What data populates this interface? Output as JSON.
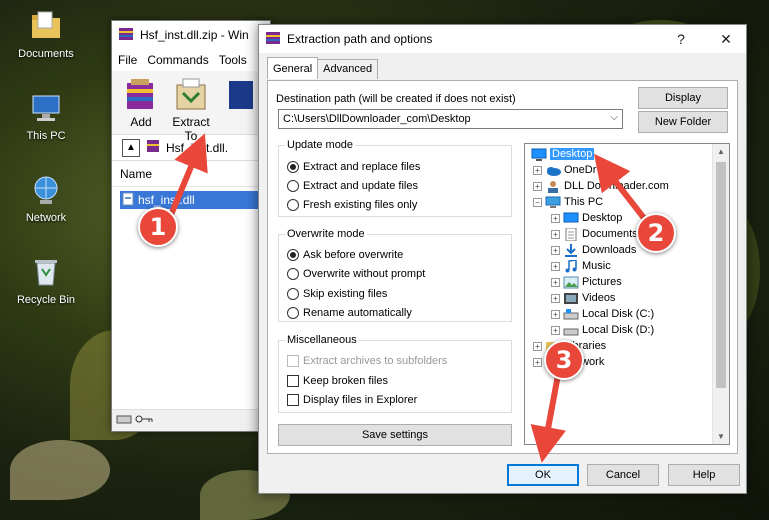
{
  "desktop": {
    "icons": [
      {
        "label": "Documents",
        "icon": "documents-folder-icon"
      },
      {
        "label": "This PC",
        "icon": "this-pc-icon"
      },
      {
        "label": "Network",
        "icon": "network-icon"
      },
      {
        "label": "Recycle Bin",
        "icon": "recycle-bin-icon"
      }
    ]
  },
  "winrar": {
    "title": "Hsf_inst.dll.zip - Win",
    "menu": [
      "File",
      "Commands",
      "Tools"
    ],
    "tools": [
      {
        "label": "Add",
        "icon": "add-archive-icon"
      },
      {
        "label": "Extract To",
        "icon": "extract-to-icon"
      }
    ],
    "address": "Hsf_inst.dll.",
    "column_name": "Name",
    "file": "hsf_inst.dll"
  },
  "dialog": {
    "title": "Extraction path and options",
    "help": "?",
    "close": "✕",
    "tabs": [
      "General",
      "Advanced"
    ],
    "dest_label": "Destination path (will be created if does not exist)",
    "dest_value": "C:\\Users\\DllDownloader_com\\Desktop",
    "display_btn": "Display",
    "new_folder_btn": "New Folder",
    "update_mode": {
      "title": "Update mode",
      "options": [
        "Extract and replace files",
        "Extract and update files",
        "Fresh existing files only"
      ],
      "selected": 0
    },
    "overwrite_mode": {
      "title": "Overwrite mode",
      "options": [
        "Ask before overwrite",
        "Overwrite without prompt",
        "Skip existing files",
        "Rename automatically"
      ],
      "selected": 0
    },
    "misc": {
      "title": "Miscellaneous",
      "options": [
        "Extract archives to subfolders",
        "Keep broken files",
        "Display files in Explorer"
      ]
    },
    "save_settings": "Save settings",
    "tree": [
      {
        "label": "Desktop",
        "level": 0,
        "icon": "desktop-icon",
        "selected": true
      },
      {
        "label": "OneDr",
        "level": 1,
        "icon": "onedrive-icon"
      },
      {
        "label": "DLL Downloader.com",
        "level": 1,
        "icon": "user-icon"
      },
      {
        "label": "This PC",
        "level": 1,
        "icon": "this-pc-icon"
      },
      {
        "label": "Desktop",
        "level": 2,
        "icon": "desktop-icon"
      },
      {
        "label": "Documents",
        "level": 2,
        "icon": "documents-icon"
      },
      {
        "label": "Downloads",
        "level": 2,
        "icon": "downloads-icon"
      },
      {
        "label": "Music",
        "level": 2,
        "icon": "music-icon"
      },
      {
        "label": "Pictures",
        "level": 2,
        "icon": "pictures-icon"
      },
      {
        "label": "Videos",
        "level": 2,
        "icon": "videos-icon"
      },
      {
        "label": "Local Disk (C:)",
        "level": 2,
        "icon": "drive-icon"
      },
      {
        "label": "Local Disk (D:)",
        "level": 2,
        "icon": "drive-icon"
      },
      {
        "label": "Libraries",
        "level": 1,
        "icon": "libraries-icon"
      },
      {
        "label": "Network",
        "level": 1,
        "icon": "network-icon"
      }
    ],
    "ok": "OK",
    "cancel": "Cancel",
    "help_btn": "Help"
  },
  "steps": [
    "1",
    "2",
    "3"
  ],
  "accent": "#e8473a"
}
